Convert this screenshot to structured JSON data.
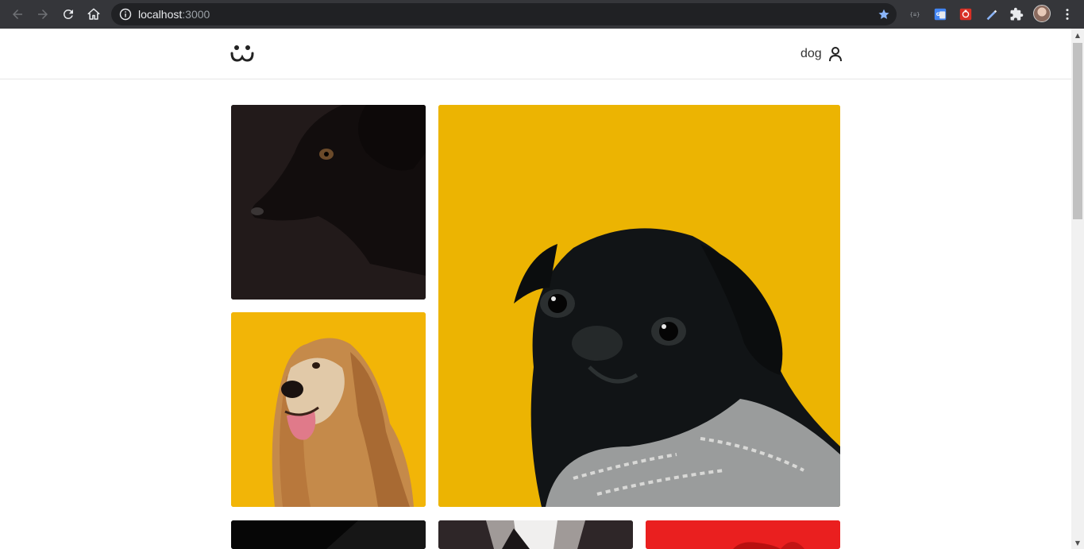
{
  "browser": {
    "url_host": "localhost",
    "url_port": ":3000"
  },
  "header": {
    "username": "dog"
  },
  "icons": {
    "back": "back-arrow-icon",
    "forward": "forward-arrow-icon",
    "reload": "reload-icon",
    "home": "home-icon",
    "info": "info-icon",
    "bookmark": "star-icon",
    "extensions": "puzzle-icon",
    "menu": "kebab-menu-icon",
    "logo": "smiley-logo-icon",
    "user": "user-icon"
  },
  "colors": {
    "chrome_bg": "#35363a",
    "omnibox_bg": "#202124",
    "bookmark_star": "#8ab4f8",
    "yellow_photo_bg": "#ecb402",
    "red_photo_bg": "#e81c1c",
    "dark_photo_bg": "#231a1a"
  }
}
